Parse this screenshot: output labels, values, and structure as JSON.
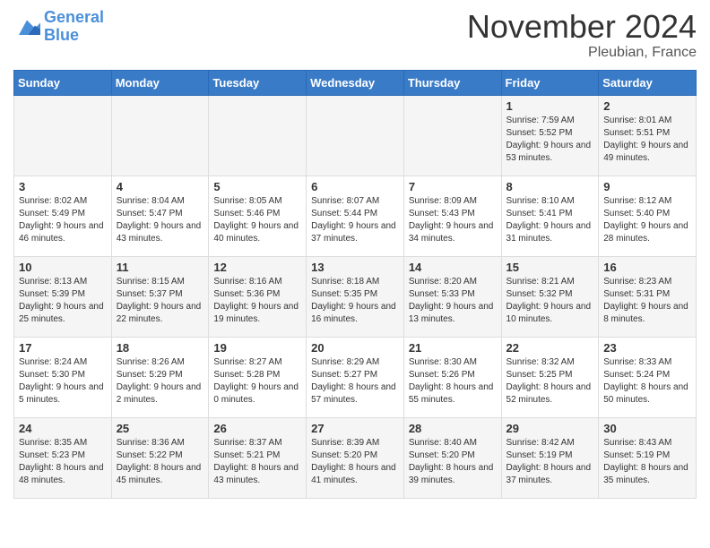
{
  "logo": {
    "text_general": "General",
    "text_blue": "Blue"
  },
  "header": {
    "month": "November 2024",
    "location": "Pleubian, France"
  },
  "weekdays": [
    "Sunday",
    "Monday",
    "Tuesday",
    "Wednesday",
    "Thursday",
    "Friday",
    "Saturday"
  ],
  "weeks": [
    [
      {
        "day": "",
        "info": ""
      },
      {
        "day": "",
        "info": ""
      },
      {
        "day": "",
        "info": ""
      },
      {
        "day": "",
        "info": ""
      },
      {
        "day": "",
        "info": ""
      },
      {
        "day": "1",
        "info": "Sunrise: 7:59 AM\nSunset: 5:52 PM\nDaylight: 9 hours and 53 minutes."
      },
      {
        "day": "2",
        "info": "Sunrise: 8:01 AM\nSunset: 5:51 PM\nDaylight: 9 hours and 49 minutes."
      }
    ],
    [
      {
        "day": "3",
        "info": "Sunrise: 8:02 AM\nSunset: 5:49 PM\nDaylight: 9 hours and 46 minutes."
      },
      {
        "day": "4",
        "info": "Sunrise: 8:04 AM\nSunset: 5:47 PM\nDaylight: 9 hours and 43 minutes."
      },
      {
        "day": "5",
        "info": "Sunrise: 8:05 AM\nSunset: 5:46 PM\nDaylight: 9 hours and 40 minutes."
      },
      {
        "day": "6",
        "info": "Sunrise: 8:07 AM\nSunset: 5:44 PM\nDaylight: 9 hours and 37 minutes."
      },
      {
        "day": "7",
        "info": "Sunrise: 8:09 AM\nSunset: 5:43 PM\nDaylight: 9 hours and 34 minutes."
      },
      {
        "day": "8",
        "info": "Sunrise: 8:10 AM\nSunset: 5:41 PM\nDaylight: 9 hours and 31 minutes."
      },
      {
        "day": "9",
        "info": "Sunrise: 8:12 AM\nSunset: 5:40 PM\nDaylight: 9 hours and 28 minutes."
      }
    ],
    [
      {
        "day": "10",
        "info": "Sunrise: 8:13 AM\nSunset: 5:39 PM\nDaylight: 9 hours and 25 minutes."
      },
      {
        "day": "11",
        "info": "Sunrise: 8:15 AM\nSunset: 5:37 PM\nDaylight: 9 hours and 22 minutes."
      },
      {
        "day": "12",
        "info": "Sunrise: 8:16 AM\nSunset: 5:36 PM\nDaylight: 9 hours and 19 minutes."
      },
      {
        "day": "13",
        "info": "Sunrise: 8:18 AM\nSunset: 5:35 PM\nDaylight: 9 hours and 16 minutes."
      },
      {
        "day": "14",
        "info": "Sunrise: 8:20 AM\nSunset: 5:33 PM\nDaylight: 9 hours and 13 minutes."
      },
      {
        "day": "15",
        "info": "Sunrise: 8:21 AM\nSunset: 5:32 PM\nDaylight: 9 hours and 10 minutes."
      },
      {
        "day": "16",
        "info": "Sunrise: 8:23 AM\nSunset: 5:31 PM\nDaylight: 9 hours and 8 minutes."
      }
    ],
    [
      {
        "day": "17",
        "info": "Sunrise: 8:24 AM\nSunset: 5:30 PM\nDaylight: 9 hours and 5 minutes."
      },
      {
        "day": "18",
        "info": "Sunrise: 8:26 AM\nSunset: 5:29 PM\nDaylight: 9 hours and 2 minutes."
      },
      {
        "day": "19",
        "info": "Sunrise: 8:27 AM\nSunset: 5:28 PM\nDaylight: 9 hours and 0 minutes."
      },
      {
        "day": "20",
        "info": "Sunrise: 8:29 AM\nSunset: 5:27 PM\nDaylight: 8 hours and 57 minutes."
      },
      {
        "day": "21",
        "info": "Sunrise: 8:30 AM\nSunset: 5:26 PM\nDaylight: 8 hours and 55 minutes."
      },
      {
        "day": "22",
        "info": "Sunrise: 8:32 AM\nSunset: 5:25 PM\nDaylight: 8 hours and 52 minutes."
      },
      {
        "day": "23",
        "info": "Sunrise: 8:33 AM\nSunset: 5:24 PM\nDaylight: 8 hours and 50 minutes."
      }
    ],
    [
      {
        "day": "24",
        "info": "Sunrise: 8:35 AM\nSunset: 5:23 PM\nDaylight: 8 hours and 48 minutes."
      },
      {
        "day": "25",
        "info": "Sunrise: 8:36 AM\nSunset: 5:22 PM\nDaylight: 8 hours and 45 minutes."
      },
      {
        "day": "26",
        "info": "Sunrise: 8:37 AM\nSunset: 5:21 PM\nDaylight: 8 hours and 43 minutes."
      },
      {
        "day": "27",
        "info": "Sunrise: 8:39 AM\nSunset: 5:20 PM\nDaylight: 8 hours and 41 minutes."
      },
      {
        "day": "28",
        "info": "Sunrise: 8:40 AM\nSunset: 5:20 PM\nDaylight: 8 hours and 39 minutes."
      },
      {
        "day": "29",
        "info": "Sunrise: 8:42 AM\nSunset: 5:19 PM\nDaylight: 8 hours and 37 minutes."
      },
      {
        "day": "30",
        "info": "Sunrise: 8:43 AM\nSunset: 5:19 PM\nDaylight: 8 hours and 35 minutes."
      }
    ]
  ]
}
